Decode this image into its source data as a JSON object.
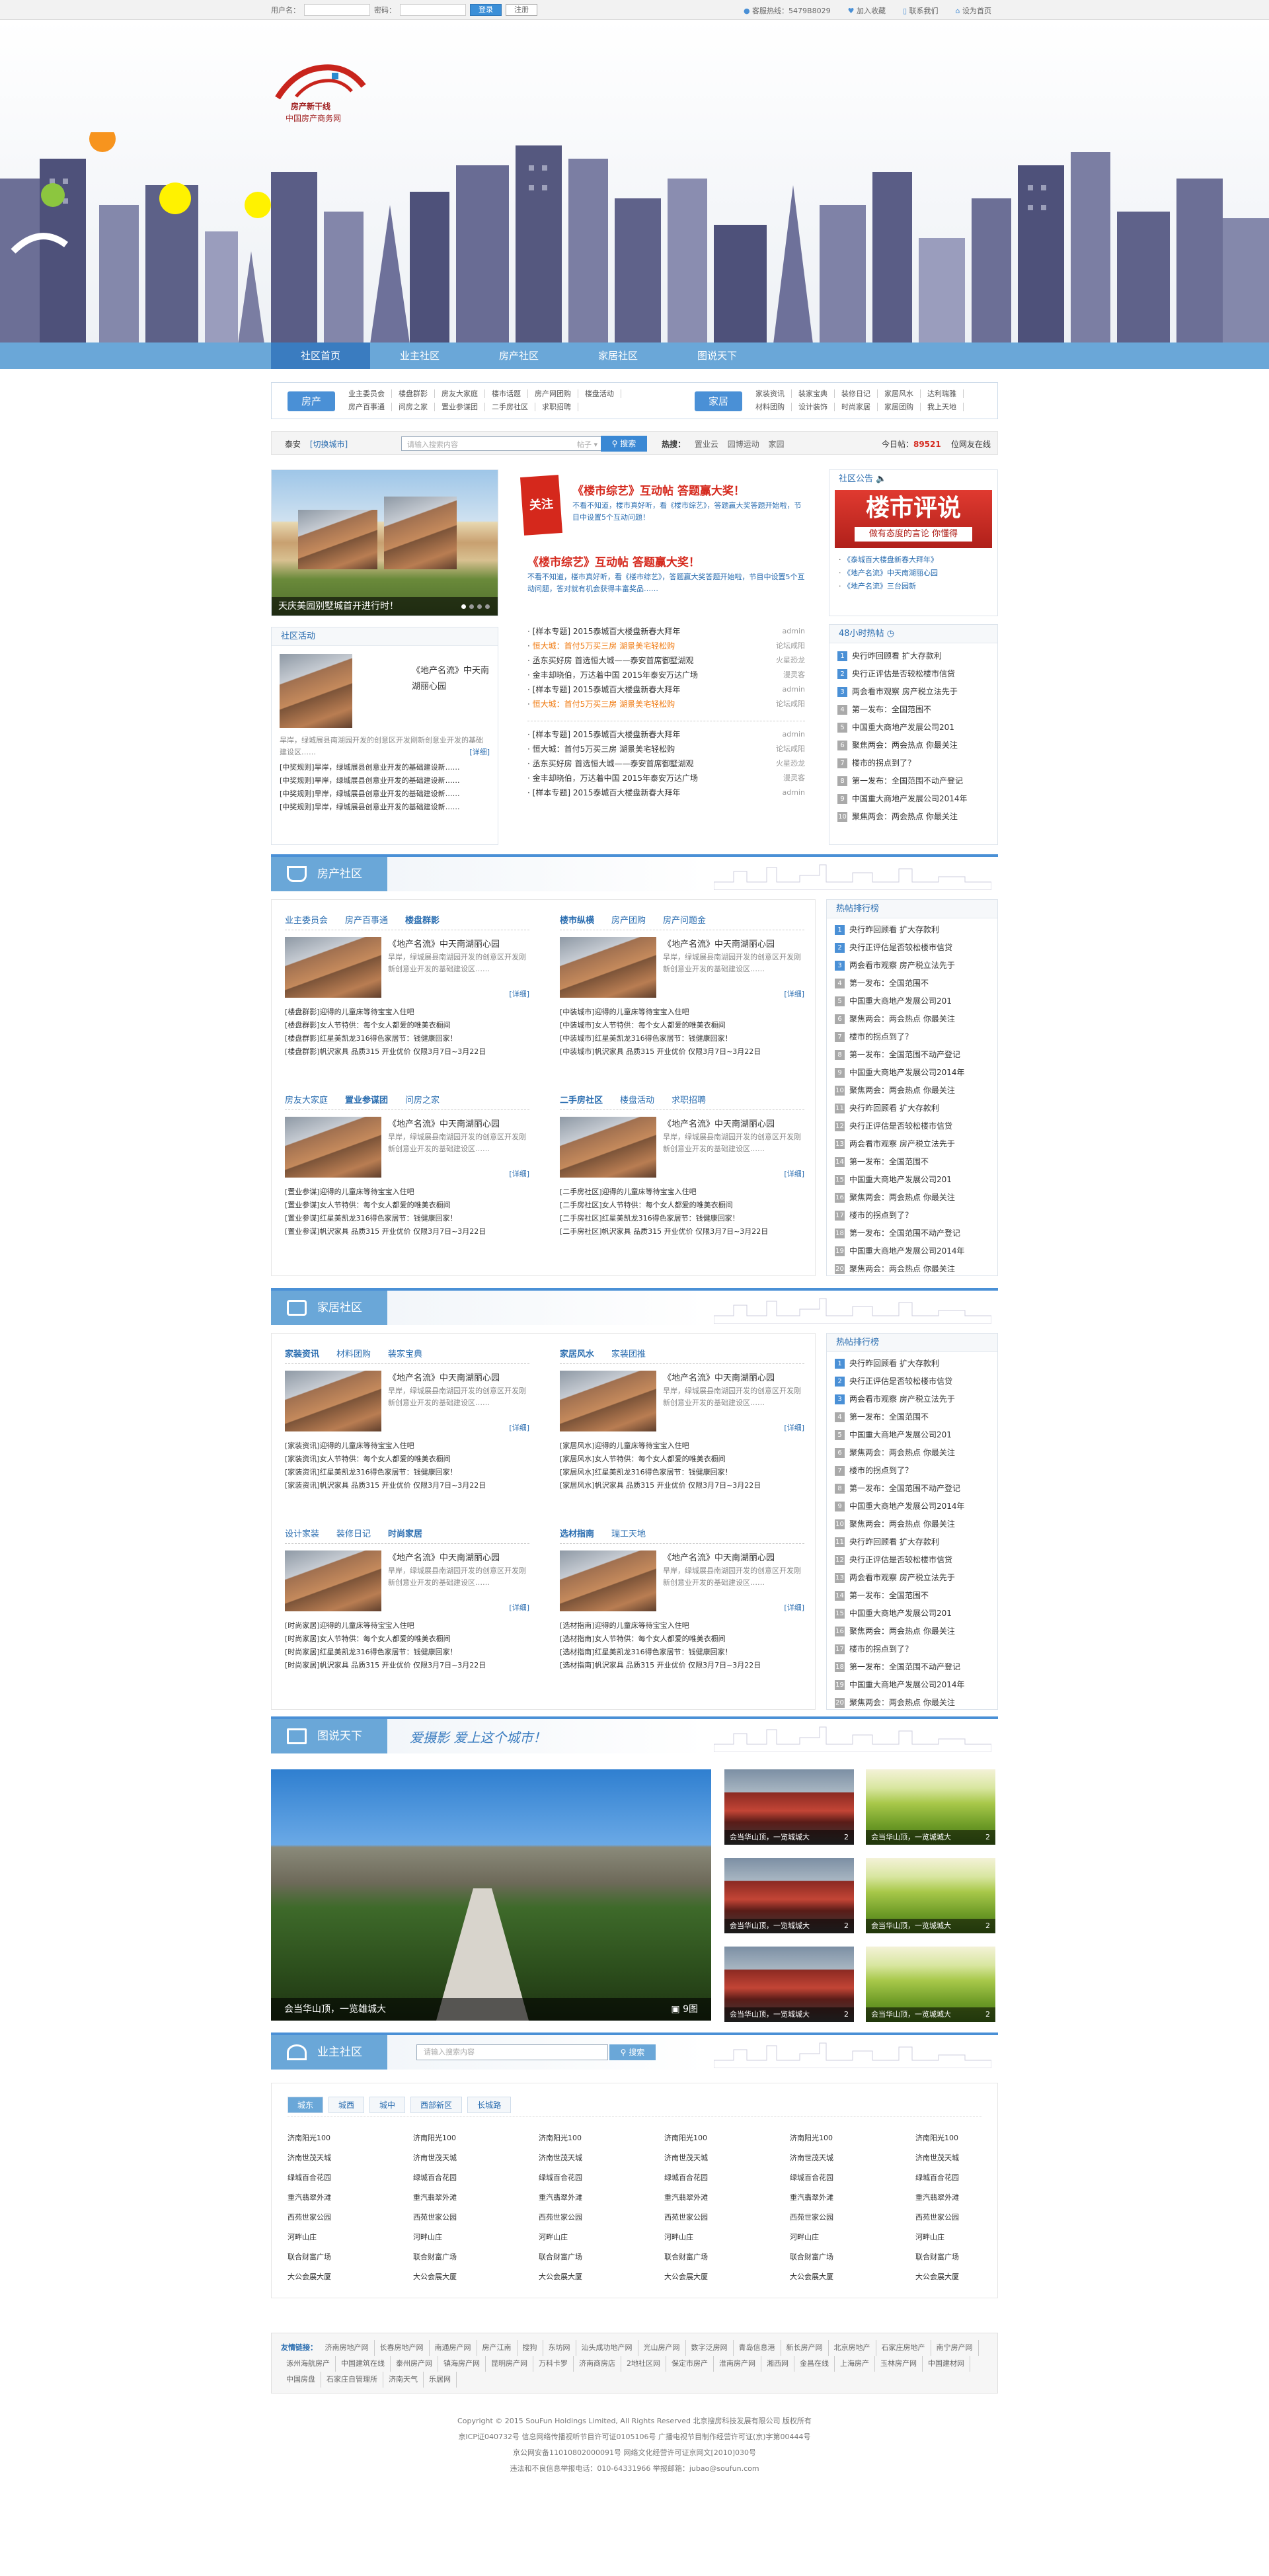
{
  "topbar": {
    "username_label": "用户名：",
    "password_label": "密码：",
    "login_btn": "登录",
    "register_btn": "注册",
    "service": "客服热线：5479B8029",
    "favorite": "加入收藏",
    "contact": "联系我们",
    "sethome": "设为首页"
  },
  "logo": {
    "line1": "房产新干线",
    "line2": "中国房产商务网"
  },
  "nav": [
    "社区首页",
    "业主社区",
    "房产社区",
    "家居社区",
    "图说天下"
  ],
  "channels": {
    "house": {
      "tag": "房产",
      "links": [
        [
          "业主委员会",
          "楼盘群影",
          "房友大家庭",
          "楼市话题",
          "房产网团购",
          "楼盘活动"
        ],
        [
          "房产百事通",
          "问房之家",
          "置业参谋团",
          "二手房社区",
          "求职招聘"
        ]
      ]
    },
    "home": {
      "tag": "家居",
      "links": [
        [
          "家装资讯",
          "装家宝典",
          "装修日记",
          "家居风水",
          "达利瑞雅"
        ],
        [
          "材料团购",
          "设计装饰",
          "时尚家居",
          "家居团购",
          "我上天地"
        ]
      ]
    }
  },
  "search": {
    "city": "泰安",
    "switch": "[切换城市]",
    "placeholder": "请输入搜索内容",
    "type": "帖子",
    "button": "搜索",
    "hot_label": "热搜：",
    "hot": [
      "置业云",
      "园博运动",
      "家园"
    ],
    "today_label": "今日帖",
    "today": "89521",
    "online": "位网友在线"
  },
  "focus": {
    "caption": "天庆美园别墅城首开进行时！"
  },
  "activity": {
    "title": "社区活动",
    "pic_title": "《地产名流》中天南湖丽心园",
    "desc": "旱岸，绿城展县南湖园开发的创意区开发刚新创意业开发的基础建设区……",
    "more": "[详细]",
    "items": [
      "[中奖规则]旱岸，绿城展县创意业开发的基础建设新……",
      "[中奖规则]旱岸，绿城展县创意业开发的基础建设新……",
      "[中奖规则]旱岸，绿城展县创意业开发的基础建设新……",
      "[中奖规则]旱岸，绿城展县创意业开发的基础建设新……"
    ]
  },
  "headline": {
    "badge": "关注",
    "h1": "《楼市综艺》互动帖 答题赢大奖！",
    "h1sub": "不看不知道，楼市真好听，看《楼市综艺》，答题赢大奖答题开始啦，节目中设置5个互动问题！",
    "h2": "《楼市综艺》互动帖 答题赢大奖！",
    "h2sub": "不看不知道，楼市真好听，看《楼市综艺》，答题赢大奖答题开始啦，节目中设置5个互动问题，答对就有机会获得丰富奖品……",
    "news": [
      {
        "t": "[样本专题] 2015泰城百大楼盘新春大拜年",
        "r": "admin",
        "c": ""
      },
      {
        "t": "恒大城：首付5万买三房 湖景美宅轻松购",
        "r": "论坛咸阳",
        "c": "orange"
      },
      {
        "t": "丞东买好房 首选恒大城——泰安首席御墅湖观",
        "r": "火星恐龙",
        "c": ""
      },
      {
        "t": "金丰却晓伯，万达着中国 2015年泰安万达广场",
        "r": "漫灵客",
        "c": ""
      },
      {
        "t": "[样本专题] 2015泰城百大楼盘新春大拜年",
        "r": "admin",
        "c": ""
      },
      {
        "t": "恒大城：首付5万买三房 湖景美宅轻松购",
        "r": "论坛咸阳",
        "c": "orange"
      }
    ],
    "news2": [
      {
        "t": "[样本专题] 2015泰城百大楼盘新春大拜年",
        "r": "admin"
      },
      {
        "t": "恒大城：首付5万买三房 湖景美宅轻松购",
        "r": "论坛咸阳"
      },
      {
        "t": "丞东买好房 首选恒大城——泰安首席御墅湖观",
        "r": "火星恐龙"
      },
      {
        "t": "金丰却晓伯，万达着中国 2015年泰安万达广场",
        "r": "漫灵客"
      },
      {
        "t": "[样本专题] 2015泰城百大楼盘新春大拜年",
        "r": "admin"
      }
    ]
  },
  "notice": {
    "title": "社区公告",
    "banner1": "楼市评说",
    "banner2": "做有态度的言论 你懂得",
    "items": [
      "《泰城百大楼盘新春大拜年》",
      "《地产名流》中天南湖丽心园",
      "《地产名流》三台园新"
    ]
  },
  "hot48": {
    "title": "48小时热帖",
    "items": [
      "央行昨回顾看 扩大存款利",
      "央行正评估是否较松楼市信贷",
      "两会看市观察 房产税立法先于",
      "第一发布：全国范围不",
      "中国重大商地产发展公司201",
      "聚焦两会：两会热点 你最关注",
      "楼市的拐点到了？",
      "第一发布：全国范围不动产登记",
      "中国重大商地产发展公司2014年",
      "聚焦两会：两会热点 你最关注"
    ]
  },
  "house": {
    "title": "房产社区",
    "blocks": [
      {
        "tabs": [
          "业主委员会",
          "房产百事通",
          "楼盘群影"
        ],
        "on": 2
      },
      {
        "tabs": [
          "楼市纵横",
          "房产团购",
          "房产问题金"
        ],
        "on": 0
      },
      {
        "tabs": [
          "房友大家庭",
          "置业参谋团",
          "问房之家"
        ],
        "on": 1
      },
      {
        "tabs": [
          "二手房社区",
          "楼盘活动",
          "求职招聘"
        ],
        "on": 0
      }
    ],
    "card": {
      "t": "《地产名流》中天南湖丽心园",
      "d": "旱岸，绿城展县南湖园开发的创意区开发刚新创意业开发的基础建设区……",
      "more": "[详细]"
    },
    "lists": [
      [
        "[楼盘群影]迎得的儿童床等待宝宝入住吧",
        "[楼盘群影]女人节特供：每个女人都爱的唯美衣橱间",
        "[楼盘群影]红星美凯龙316得色家居节：钱健康回家！",
        "[楼盘群影]帆沢家具 品质315 开业优价 仅限3月7日~3月22日"
      ],
      [
        "[中装城市]迎得的儿童床等待宝宝入住吧",
        "[中装城市]女人节特供：每个女人都爱的唯美衣橱间",
        "[中装城市]红星美凯龙316得色家居节：钱健康回家！",
        "[中装城市]帆沢家具 品质315 开业优价 仅限3月7日~3月22日"
      ],
      [
        "[置业参谋]迎得的儿童床等待宝宝入住吧",
        "[置业参谋]女人节特供：每个女人都爱的唯美衣橱间",
        "[置业参谋]红星美凯龙316得色家居节：钱健康回家！",
        "[置业参谋]帆沢家具 品质315 开业优价 仅限3月7日~3月22日"
      ],
      [
        "[二手房社区]迎得的儿童床等待宝宝入住吧",
        "[二手房社区]女人节特供：每个女人都爱的唯美衣橱间",
        "[二手房社区]红星美凯龙316得色家居节：钱健康回家！",
        "[二手房社区]帆沢家具 品质315 开业优价 仅限3月7日~3月22日"
      ]
    ],
    "hot_title": "热帖排行榜"
  },
  "home": {
    "title": "家居社区",
    "blocks": [
      {
        "tabs": [
          "家装资讯",
          "材料团购",
          "装家宝典"
        ],
        "on": 0
      },
      {
        "tabs": [
          "家居风水",
          "家装团推"
        ],
        "on": 0
      },
      {
        "tabs": [
          "设计家装",
          "装修日记",
          "时尚家居"
        ],
        "on": 2
      },
      {
        "tabs": [
          "选材指南",
          "瑞工天地"
        ],
        "on": 0
      }
    ],
    "lists": [
      [
        "[家装资讯]迎得的儿童床等待宝宝入住吧",
        "[家装资讯]女人节特供：每个女人都爱的唯美衣橱间",
        "[家装资讯]红星美凯龙316得色家居节：钱健康回家！",
        "[家装资讯]帆沢家具 品质315 开业优价 仅限3月7日~3月22日"
      ],
      [
        "[家居风水]迎得的儿童床等待宝宝入住吧",
        "[家居风水]女人节特供：每个女人都爱的唯美衣橱间",
        "[家居风水]红星美凯龙316得色家居节：钱健康回家！",
        "[家居风水]帆沢家具 品质315 开业优价 仅限3月7日~3月22日"
      ],
      [
        "[时尚家居]迎得的儿童床等待宝宝入住吧",
        "[时尚家居]女人节特供：每个女人都爱的唯美衣橱间",
        "[时尚家居]红星美凯龙316得色家居节：钱健康回家！",
        "[时尚家居]帆沢家具 品质315 开业优价 仅限3月7日~3月22日"
      ],
      [
        "[选材指南]迎得的儿童床等待宝宝入住吧",
        "[选材指南]女人节特供：每个女人都爱的唯美衣橱间",
        "[选材指南]红星美凯龙316得色家居节：钱健康回家！",
        "[选材指南]帆沢家具 品质315 开业优价 仅限3月7日~3月22日"
      ]
    ]
  },
  "gallery": {
    "title": "图说天下",
    "slogan": "爱摄影 爱上这个城市！",
    "main_caption": "会当华山顶，一览雄城大",
    "count": "9图",
    "thumb_caption": "会当华山顶，一览城城大",
    "thumb_count": "2"
  },
  "owner": {
    "title": "业主社区",
    "placeholder": "请输入搜索内容",
    "button": "搜索",
    "tabs": [
      "城东",
      "城西",
      "城中",
      "西部新区",
      "长城路"
    ],
    "names": [
      "济南阳光100",
      "济南世茂天城",
      "绿城百合花园",
      "重汽翡翠外滩",
      "西苑世家公园",
      "河畔山庄",
      "联合财富广场",
      "大公会展大厦"
    ]
  },
  "links": {
    "label": "友情链接：",
    "items": [
      "济南房地产网",
      "长春房地产网",
      "南通房产网",
      "房产江南",
      "搜狗",
      "东坊网",
      "汕头成功地产网",
      "光山房产网",
      "数字泛房网",
      "青岛信息港",
      "新长房产网",
      "北京房地产",
      "石家庄房地产",
      "南宁房产网",
      "涿州海航房产",
      "中国建筑在线",
      "泰州房产网",
      "镇海房产网",
      "昆明房产网",
      "万科卡罗",
      "济南商房店",
      "2地社区网",
      "保定市房产",
      "淮南房产网",
      "湘西网",
      "金昌在线",
      "上海房产",
      "玉林房产网",
      "中国建材网",
      "中国房盘",
      "石家庄自管理所",
      "济南天气",
      "乐居网"
    ]
  },
  "copyright": {
    "l1": "Copyright © 2015 SouFun Holdings Limited, All Rights Reserved 北京搜房科技发展有限公司 版权所有",
    "l2": "京ICP证040732号 信息网络传播视听节目许可证0105106号 广播电视节目制作经营许可证(京)字第00444号",
    "l3": "京公网安备11010802000091号 网络文化经营许可证京网文[2010]030号",
    "l4": "违法和不良信息举报电话：010-64331966 举报邮箱：jubao@soufun.com"
  }
}
